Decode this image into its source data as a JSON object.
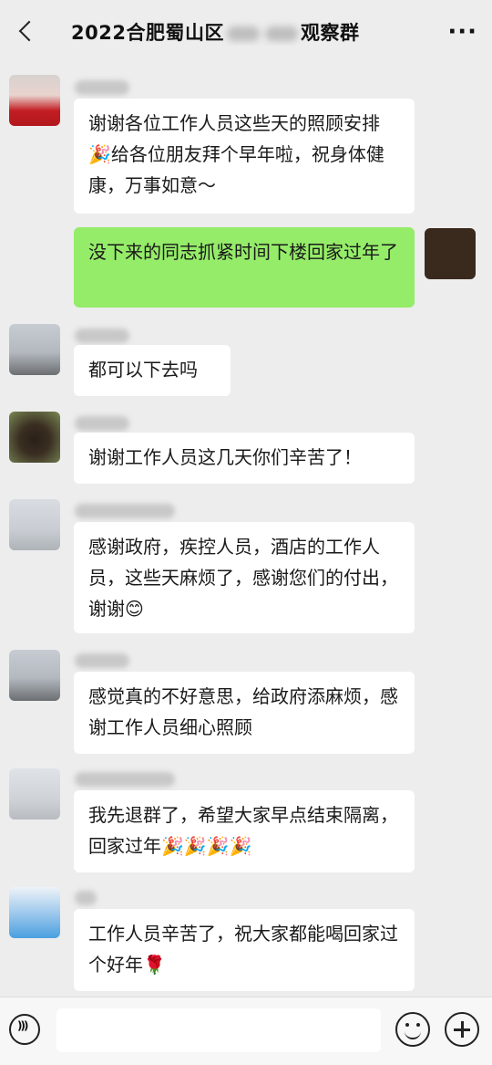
{
  "header": {
    "title_prefix": "2022合肥蜀山区",
    "title_suffix": "观察群",
    "more": "···"
  },
  "messages": [
    {
      "text": "谢谢各位工作人员这些天的照顾安排🎉给各位朋友拜个早年啦，祝身体健康，万事如意～"
    },
    {
      "text": "没下来的同志抓紧时间下楼回家过年了"
    },
    {
      "text": "都可以下去吗"
    },
    {
      "text": "谢谢工作人员这几天你们辛苦了！"
    },
    {
      "text": "感谢政府，疾控人员，酒店的工作人员，这些天麻烦了，感谢您们的付出，谢谢😊"
    },
    {
      "text": "感觉真的不好意思，给政府添麻烦，感谢工作人员细心照顾"
    },
    {
      "text": "我先退群了，希望大家早点结束隔离，回家过年🎉🎉🎉🎉"
    },
    {
      "text": "工作人员辛苦了，祝大家都能喝回家过个好年🌹"
    }
  ],
  "colors": {
    "background": "#ededed",
    "bubble_self": "#95ec69",
    "bubble_other": "#ffffff"
  },
  "icons": {
    "back": "chevron-left-icon",
    "more": "more-dots-icon",
    "voice": "voice-icon",
    "emoji": "emoji-icon",
    "plus": "plus-icon"
  }
}
